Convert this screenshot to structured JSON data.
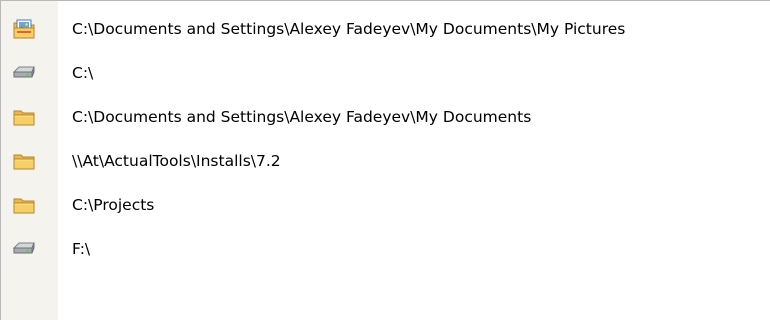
{
  "menu": {
    "items": [
      {
        "icon": "pictures-folder-icon",
        "label": "C:\\Documents and Settings\\Alexey Fadeyev\\My Documents\\My Pictures"
      },
      {
        "icon": "drive-icon",
        "label": "C:\\"
      },
      {
        "icon": "folder-icon",
        "label": "C:\\Documents and Settings\\Alexey Fadeyev\\My Documents"
      },
      {
        "icon": "folder-icon",
        "label": "\\\\At\\ActualTools\\Installs\\7.2"
      },
      {
        "icon": "folder-icon",
        "label": "C:\\Projects"
      },
      {
        "icon": "drive-icon",
        "label": "F:\\"
      }
    ]
  },
  "colors": {
    "gutter": "#f4f3ee",
    "folder": "#f4c85a",
    "drive": "#9ea2a8"
  }
}
